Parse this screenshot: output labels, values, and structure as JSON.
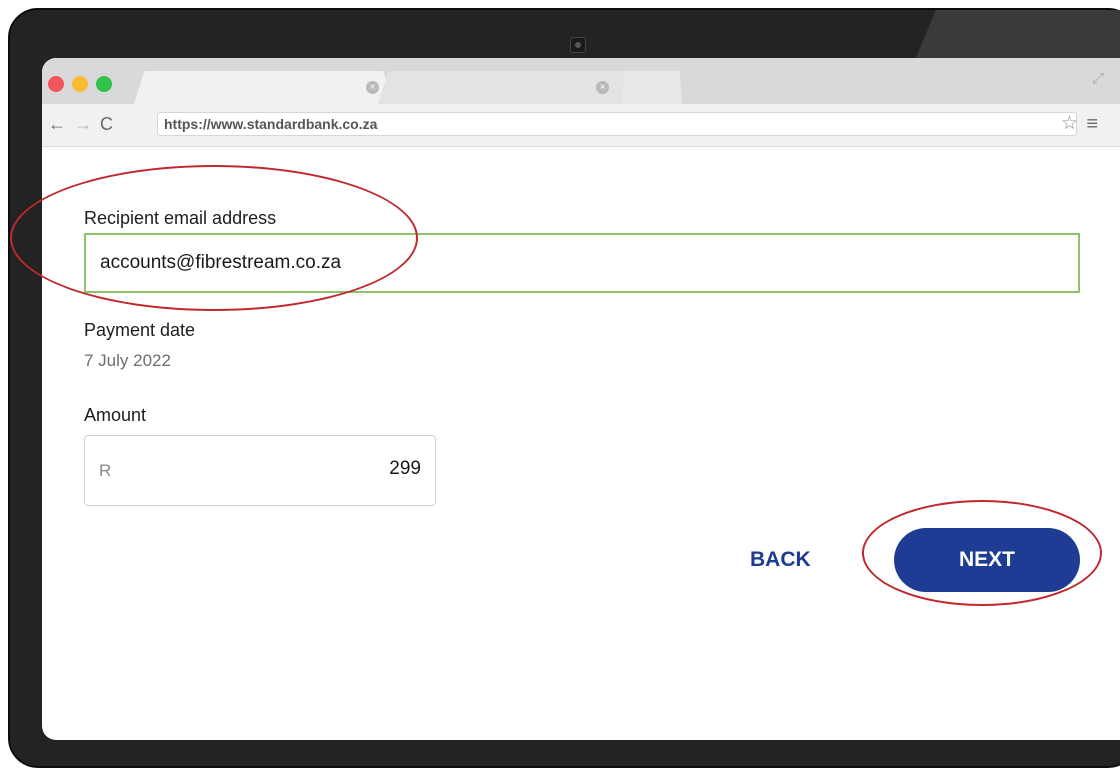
{
  "browser": {
    "url": "https://www.standardbank.co.za",
    "tab_close_glyph": "×",
    "icons": {
      "back": "←",
      "forward": "→",
      "reload": "C",
      "star": "☆",
      "menu": "≡",
      "expand": "⤢"
    }
  },
  "form": {
    "email_label": "Recipient email address",
    "email_value": "accounts@fibrestream.co.za",
    "date_label": "Payment date",
    "date_value": "7 July 2022",
    "amount_label": "Amount",
    "currency": "R",
    "amount_value": "299"
  },
  "actions": {
    "back_label": "BACK",
    "next_label": "NEXT"
  },
  "colors": {
    "accent": "#1e3c94",
    "annotation": "#c0282e",
    "input_border_active": "#8ac56a"
  }
}
